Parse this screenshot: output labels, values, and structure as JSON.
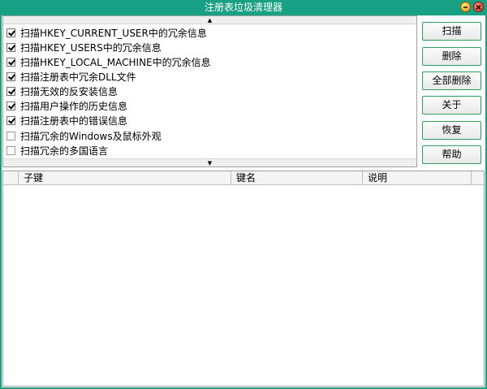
{
  "window": {
    "title": "注册表垃圾清理器"
  },
  "colors": {
    "titlebar": "#17a083",
    "button_border": "#2f9f5f"
  },
  "options": [
    {
      "label": "扫描HKEY_CURRENT_USER中的冗余信息",
      "checked": true
    },
    {
      "label": "扫描HKEY_USERS中的冗余信息",
      "checked": true
    },
    {
      "label": "扫描HKEY_LOCAL_MACHINE中的冗余信息",
      "checked": true
    },
    {
      "label": "扫描注册表中冗余DLL文件",
      "checked": true
    },
    {
      "label": "扫描无效的反安装信息",
      "checked": true
    },
    {
      "label": "扫描用户操作的历史信息",
      "checked": true
    },
    {
      "label": "扫描注册表中的错误信息",
      "checked": true
    },
    {
      "label": "扫描冗余的Windows及鼠标外观",
      "checked": false
    },
    {
      "label": "扫描冗余的多国语言",
      "checked": false
    }
  ],
  "buttons": {
    "scan": "扫描",
    "delete": "删除",
    "delete_all": "全部删除",
    "about": "关于",
    "restore": "恢复",
    "help": "帮助"
  },
  "table": {
    "columns": [
      "子键",
      "键名",
      "说明"
    ]
  },
  "icons": {
    "scroll_up": "▲",
    "scroll_down": "▼"
  }
}
